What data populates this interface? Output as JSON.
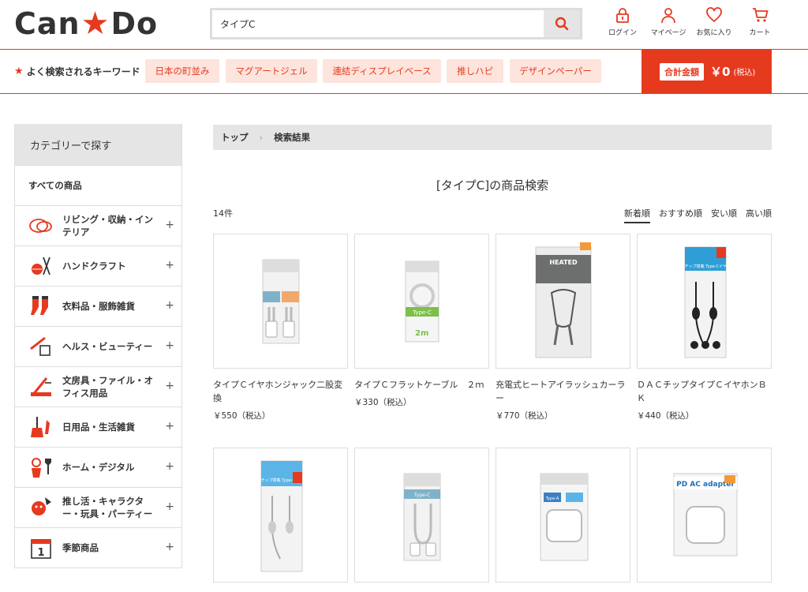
{
  "header": {
    "logo_left": "Can",
    "logo_right": "Do",
    "search_value": "タイプC",
    "icons": [
      {
        "icon": "lock-icon",
        "label": "ログイン"
      },
      {
        "icon": "person-icon",
        "label": "マイページ"
      },
      {
        "icon": "heart-icon",
        "label": "お気に入り"
      },
      {
        "icon": "cart-icon",
        "label": "カート"
      }
    ]
  },
  "keywords": {
    "title": "よく検索されるキーワード",
    "items": [
      "日本の町並み",
      "マグアートジェル",
      "連結ディスプレイベース",
      "推しハピ",
      "デザインペーパー"
    ]
  },
  "cart_total": {
    "label": "合計金額",
    "amount": "￥0",
    "tax": "(税込)"
  },
  "sidebar": {
    "title": "カテゴリーで探す",
    "all": "すべての商品",
    "items": [
      {
        "label": "リビング・収納・インテリア",
        "icon": "living-icon"
      },
      {
        "label": "ハンドクラフト",
        "icon": "craft-icon"
      },
      {
        "label": "衣料品・服飾雑貨",
        "icon": "socks-icon"
      },
      {
        "label": "ヘルス・ビューティー",
        "icon": "beauty-icon"
      },
      {
        "label": "文房具・ファイル・オフィス用品",
        "icon": "stationery-icon"
      },
      {
        "label": "日用品・生活雑貨",
        "icon": "broom-icon"
      },
      {
        "label": "ホーム・デジタル",
        "icon": "home-digital-icon"
      },
      {
        "label": "推し活・キャラクター・玩具・パーティー",
        "icon": "party-icon"
      },
      {
        "label": "季節商品",
        "icon": "calendar-icon"
      }
    ],
    "calendar_day": "1"
  },
  "breadcrumb": {
    "home": "トップ",
    "current": "検索結果"
  },
  "results": {
    "title": "[タイプC]の商品検索",
    "count": "14件",
    "sorts": [
      "新着順",
      "おすすめ順",
      "安い順",
      "高い順"
    ],
    "products": [
      {
        "name": "タイプＣイヤホンジャック二股変換",
        "price": "￥550（税込）"
      },
      {
        "name": "タイプＣフラットケーブル　２ｍ",
        "price": "￥330（税込）",
        "pkg": "Type-C"
      },
      {
        "name": "充電式ヒートアイラッシュカーラー",
        "price": "￥770（税込）",
        "pkg": "HEATED"
      },
      {
        "name": "ＤＡＣチップタイプＣイヤホンＢＫ",
        "price": "￥440（税込）",
        "pkg": "DACチップ搭載 Type-Cイヤホン"
      },
      {
        "name": "",
        "price": "",
        "pkg": "DACチップ搭載 Type-Cイヤホン"
      },
      {
        "name": "",
        "price": "",
        "pkg": "Type-C"
      },
      {
        "name": "",
        "price": "",
        "pkg": "Type-A"
      },
      {
        "name": "",
        "price": "",
        "pkg": "PD AC adapter"
      }
    ]
  }
}
